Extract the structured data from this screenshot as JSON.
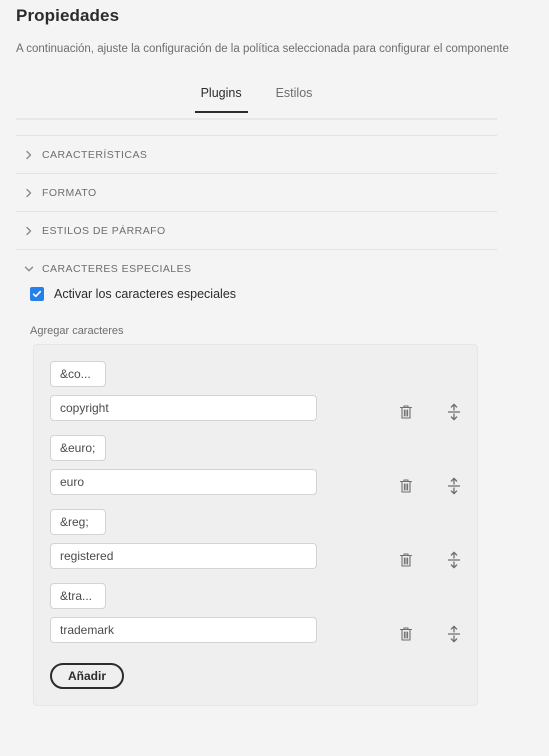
{
  "header": {
    "title": "Propiedades",
    "description": "A continuación, ajuste la configuración de la política seleccionada para configurar el componente"
  },
  "tabs": [
    {
      "label": "Plugins",
      "active": true
    },
    {
      "label": "Estilos",
      "active": false
    }
  ],
  "accordion": [
    {
      "label": "CARACTERÍSTICAS",
      "expanded": false,
      "icon": "chevron-right-icon"
    },
    {
      "label": "FORMATO",
      "expanded": false,
      "icon": "chevron-right-icon"
    },
    {
      "label": "ESTILOS DE PÁRRAFO",
      "expanded": false,
      "icon": "chevron-right-icon"
    },
    {
      "label": "CARACTERES ESPECIALES",
      "expanded": true,
      "icon": "chevron-down-icon"
    }
  ],
  "special_chars": {
    "enable_checkbox": {
      "label": "Activar los caracteres especiales",
      "checked": true
    },
    "field_label": "Agregar caracteres",
    "items": [
      {
        "entity": "&co...",
        "name": "copyright"
      },
      {
        "entity": "&euro;",
        "name": "euro"
      },
      {
        "entity": "&reg;",
        "name": "registered"
      },
      {
        "entity": "&tra...",
        "name": "trademark"
      }
    ],
    "row_actions": {
      "delete_icon": "trash-icon",
      "reorder_icon": "move-vertical-icon"
    },
    "add_button_label": "Añadir"
  },
  "colors": {
    "background": "#f4f4f4",
    "accent_checkbox": "#2680eb",
    "active_tab_underline": "#2c2c2c",
    "panel_background": "#efefef",
    "input_background": "#ffffff",
    "muted_text": "#6e6e6e"
  }
}
